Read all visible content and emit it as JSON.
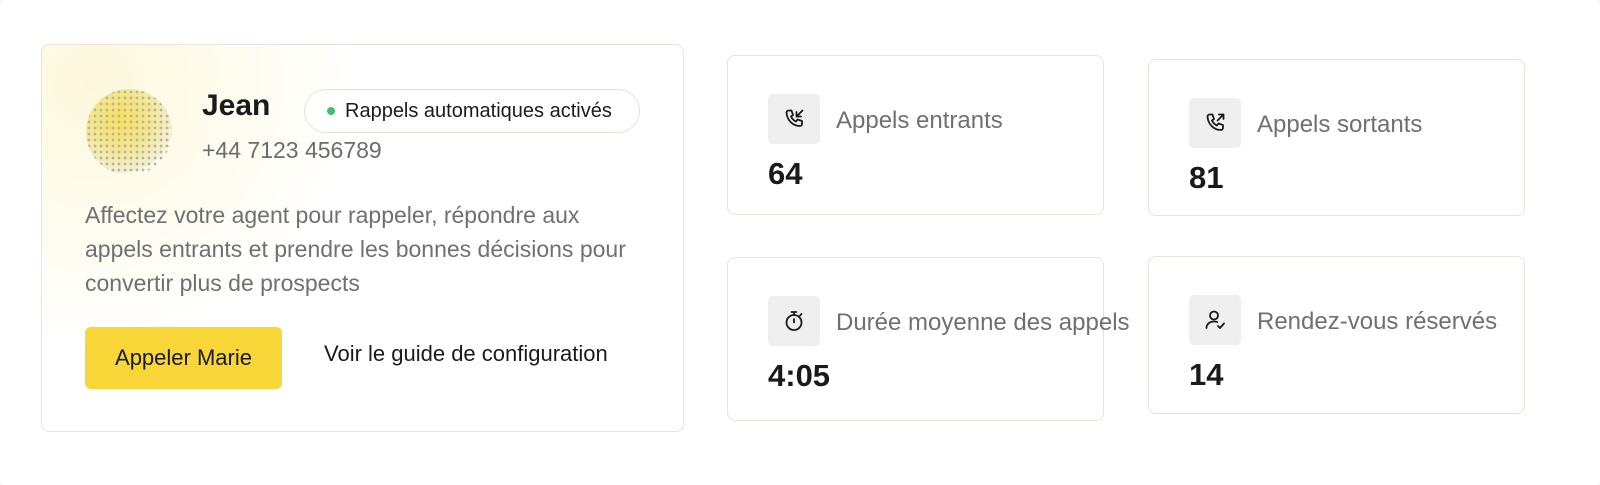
{
  "agent": {
    "name": "Jean",
    "phone": "+44 7123 456789",
    "badge_label": "Rappels automatiques activés",
    "badge_color": "#3cc26b",
    "description": "Affectez votre agent pour rappeler, répondre aux appels entrants et prendre les bonnes décisions pour convertir plus de prospects",
    "call_button_label": "Appeler Marie",
    "guide_link_label": "Voir le guide de configuration"
  },
  "stats": [
    {
      "label": "Appels entrants",
      "value": "64",
      "icon": "phone-incoming-icon"
    },
    {
      "label": "Appels sortants",
      "value": "81",
      "icon": "phone-outgoing-icon"
    },
    {
      "label": "Durée moyenne des appels",
      "value": "4:05",
      "icon": "stopwatch-icon"
    },
    {
      "label": "Rendez-vous réservés",
      "value": "14",
      "icon": "user-check-icon"
    }
  ],
  "colors": {
    "accent": "#f9d638",
    "text_primary": "#1a1a1a",
    "text_secondary": "#707070"
  }
}
